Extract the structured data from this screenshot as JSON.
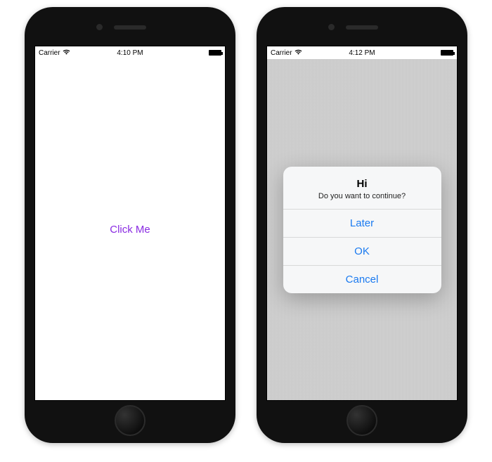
{
  "phones": {
    "left": {
      "statusbar": {
        "carrier": "Carrier",
        "time": "4:10 PM"
      },
      "button_label": "Click Me"
    },
    "right": {
      "statusbar": {
        "carrier": "Carrier",
        "time": "4:12 PM"
      },
      "alert": {
        "title": "Hi",
        "message": "Do you want to continue?",
        "buttons": {
          "later": "Later",
          "ok": "OK",
          "cancel": "Cancel"
        }
      }
    }
  }
}
